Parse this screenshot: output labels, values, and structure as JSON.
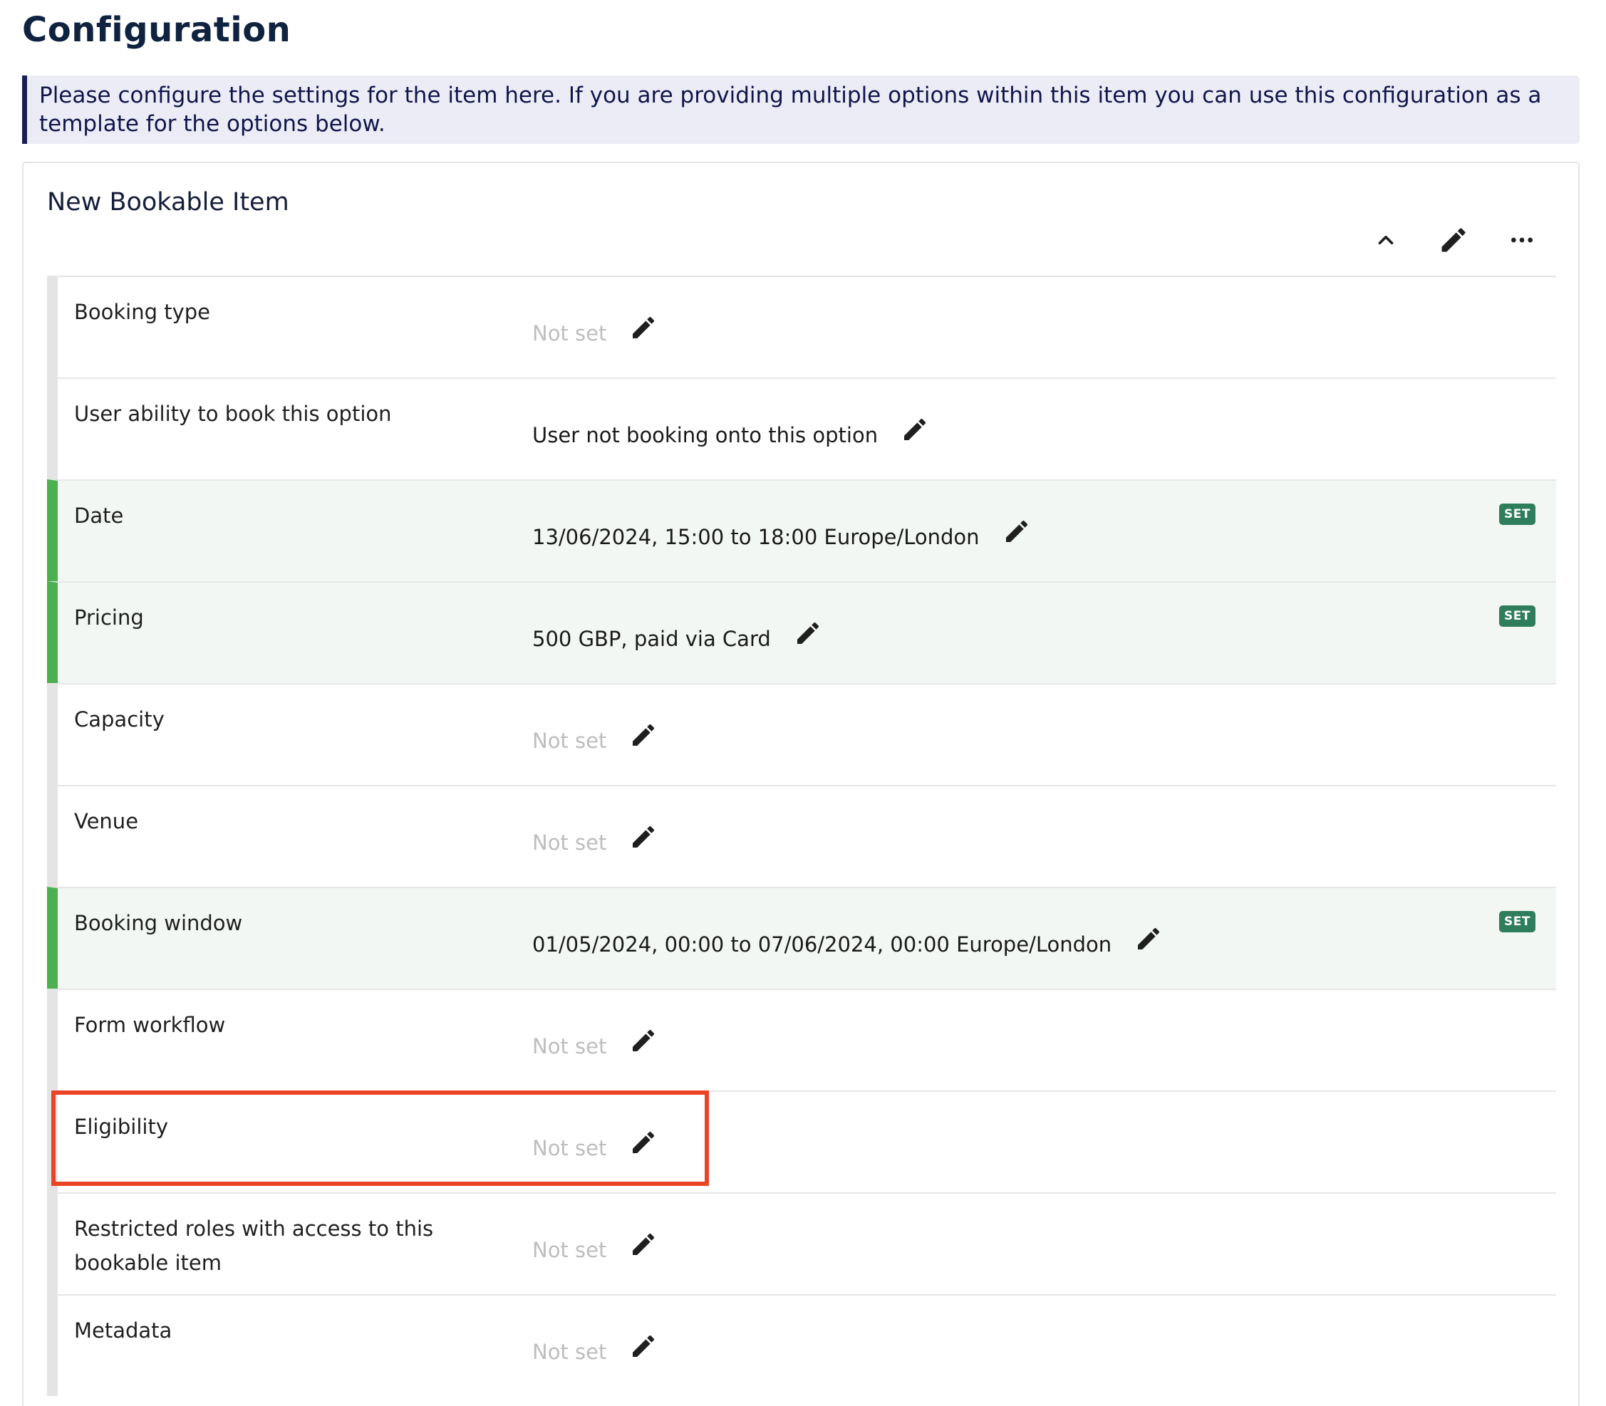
{
  "page": {
    "title": "Configuration",
    "info": "Please configure the settings for the item here. If you are providing multiple options within this item you can use this configuration as a template for the options below."
  },
  "card": {
    "title": "New Bookable Item",
    "actions": {
      "collapse_icon": "chevron-up-icon",
      "edit_icon": "pencil-icon",
      "more_icon": "more-horizontal-icon"
    }
  },
  "colors": {
    "set_accent": "#4caf50",
    "set_badge": "#2e7d5b",
    "highlight": "#ea4426",
    "banner_accent": "#1b1e52"
  },
  "rows": [
    {
      "label": "Booking type",
      "value": "Not set",
      "set": false
    },
    {
      "label": "User ability to book this option",
      "value": "User not booking onto this option",
      "set": false
    },
    {
      "label": "Date",
      "value": "13/06/2024, 15:00 to 18:00 Europe/London",
      "set": true,
      "badge": "SET"
    },
    {
      "label": "Pricing",
      "value": "500 GBP, paid via Card",
      "set": true,
      "badge": "SET"
    },
    {
      "label": "Capacity",
      "value": "Not set",
      "set": false
    },
    {
      "label": "Venue",
      "value": "Not set",
      "set": false
    },
    {
      "label": "Booking window",
      "value": "01/05/2024, 00:00 to 07/06/2024, 00:00 Europe/London",
      "set": true,
      "badge": "SET"
    },
    {
      "label": "Form workflow",
      "value": "Not set",
      "set": false
    },
    {
      "label": "Eligibility",
      "value": "Not set",
      "set": false
    },
    {
      "label": "Restricted roles with access to this bookable item",
      "value": "Not set",
      "set": false
    },
    {
      "label": "Metadata",
      "value": "Not set",
      "set": false
    }
  ]
}
